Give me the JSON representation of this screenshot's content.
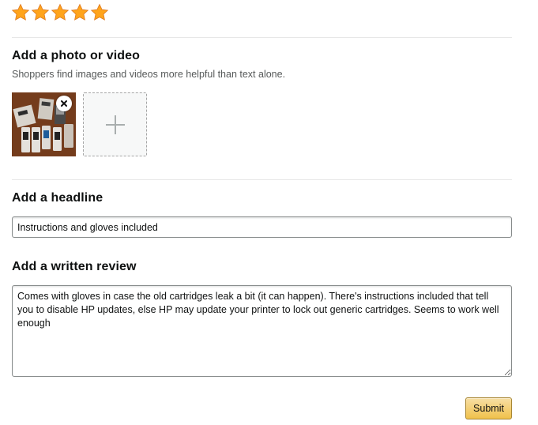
{
  "rating": {
    "stars_filled": 5,
    "stars_total": 5,
    "color": "#FFA41C"
  },
  "photo_section": {
    "title": "Add a photo or video",
    "subtitle": "Shoppers find images and videos more helpful than text alone.",
    "remove_icon": "close-icon",
    "add_icon": "plus-icon"
  },
  "headline_section": {
    "title": "Add a headline",
    "value": "Instructions and gloves included"
  },
  "review_section": {
    "title": "Add a written review",
    "value": "Comes with gloves in case the old cartridges leak a bit (it can happen). There's instructions included that tell you to disable HP updates, else HP may update your printer to lock out generic cartridges. Seems to work well enough"
  },
  "submit": {
    "label": "Submit",
    "color": "#F0C14B"
  }
}
